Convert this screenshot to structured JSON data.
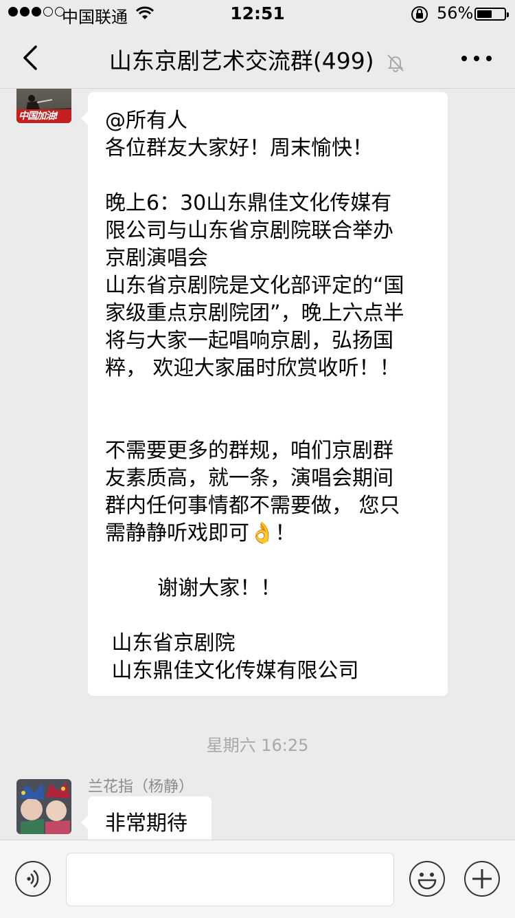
{
  "status_bar": {
    "carrier": "中国联通",
    "time": "12:51",
    "battery_percent_text": "56%",
    "battery_level": 0.56
  },
  "nav": {
    "title": "山东京剧艺术交流群(499)",
    "back_icon": "chevron-left-icon",
    "mute_icon": "bell-mute-icon",
    "more_icon": "more-dots-icon"
  },
  "messages": [
    {
      "sender": "",
      "avatar_badge": "中国加油!",
      "lines": [
        "@所有人",
        "各位群友大家好！周末愉快！",
        "",
        "晚上6：30山东鼎佳文化传媒有",
        "限公司与山东省京剧院联合举办",
        "京剧演唱会",
        "山东省京剧院是文化部评定的“国",
        "家级重点京剧院团”，晚上六点半",
        "将与大家一起唱响京剧，弘扬国",
        "粹， 欢迎大家届时欣赏收听！！",
        "",
        "",
        "不需要更多的群规，咱们京剧群",
        "友素质高，就一条，演唱会期间",
        "群内任何事情都不需要做， 您只",
        "需静静听戏即可👌！",
        "",
        "        谢谢大家！！",
        "",
        " 山东省京剧院",
        " 山东鼎佳文化传媒有限公司"
      ]
    },
    {
      "sender": "兰花指（杨静）",
      "lines": [
        "非常期待"
      ]
    }
  ],
  "time_separator": "星期六 16:25",
  "input_bar": {
    "voice_icon": "voice-icon",
    "emoji_icon": "emoji-icon",
    "plus_icon": "plus-icon",
    "placeholder": ""
  },
  "colors": {
    "background": "#ebebeb",
    "bubble": "#ffffff",
    "timestamp": "#a8a8a8",
    "sender_name": "#8c8c8c"
  }
}
